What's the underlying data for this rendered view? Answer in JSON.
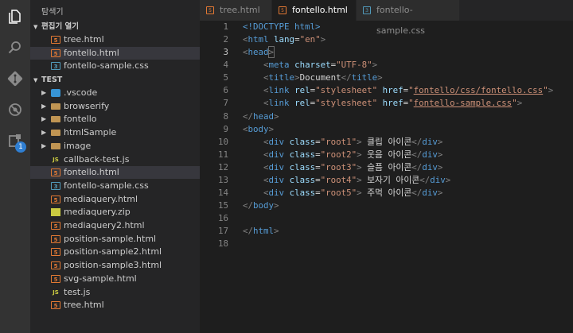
{
  "sidebar": {
    "title": "탐색기",
    "open_editors_label": "편집기 열기",
    "open_editors": [
      {
        "label": "tree.html",
        "type": "html",
        "selected": false
      },
      {
        "label": "fontello.html",
        "type": "html",
        "selected": true
      },
      {
        "label": "fontello-sample.css",
        "type": "css",
        "selected": false
      }
    ],
    "workspace_label": "TEST",
    "folders": [
      {
        "label": ".vscode",
        "type": "vscode"
      },
      {
        "label": "browserify",
        "type": "folder"
      },
      {
        "label": "fontello",
        "type": "folder"
      },
      {
        "label": "htmlSample",
        "type": "folder"
      },
      {
        "label": "image",
        "type": "folder"
      }
    ],
    "files": [
      {
        "label": "callback-test.js",
        "type": "js",
        "selected": false
      },
      {
        "label": "fontello.html",
        "type": "html",
        "selected": true
      },
      {
        "label": "fontello-sample.css",
        "type": "css",
        "selected": false
      },
      {
        "label": "mediaquery.html",
        "type": "html",
        "selected": false
      },
      {
        "label": "mediaquery.zip",
        "type": "zip",
        "selected": false
      },
      {
        "label": "mediaquery2.html",
        "type": "html",
        "selected": false
      },
      {
        "label": "position-sample.html",
        "type": "html",
        "selected": false
      },
      {
        "label": "position-sample2.html",
        "type": "html",
        "selected": false
      },
      {
        "label": "position-sample3.html",
        "type": "html",
        "selected": false
      },
      {
        "label": "svg-sample.html",
        "type": "html",
        "selected": false
      },
      {
        "label": "test.js",
        "type": "js",
        "selected": false
      },
      {
        "label": "tree.html",
        "type": "html",
        "selected": false
      }
    ]
  },
  "activity_bar": {
    "icons": [
      "files-icon",
      "search-icon",
      "source-control-icon",
      "debug-icon",
      "extensions-icon"
    ],
    "extensions_badge": "1"
  },
  "tabs": [
    {
      "label": "tree.html",
      "type": "html",
      "active": false
    },
    {
      "label": "fontello.html",
      "type": "html",
      "active": true
    },
    {
      "label": "fontello-sample.css",
      "type": "css",
      "active": false
    }
  ],
  "editor": {
    "line_numbers": [
      "1",
      "2",
      "3",
      "4",
      "5",
      "6",
      "7",
      "8",
      "9",
      "10",
      "11",
      "12",
      "13",
      "14",
      "15",
      "16",
      "17",
      "18"
    ],
    "lines": [
      "<!DOCTYPE html>",
      "<html lang=\"en\">",
      "<head>",
      "    <meta charset=\"UTF-8\">",
      "    <title>Document</title>",
      "    <link rel=\"stylesheet\" href=\"fontello/css/fontello.css\">",
      "    <link rel=\"stylesheet\" href=\"fontello-sample.css\">",
      "</head>",
      "<body>",
      "    <div class=\"root1\"> 클립 아이콘</div>",
      "    <div class=\"root2\"> 웃음 아이콘</div>",
      "    <div class=\"root3\"> 슬픔 아이콘</div>",
      "    <div class=\"root4\"> 보자기 아이콘</div>",
      "    <div class=\"root5\"> 주먹 아이콘</div>",
      "</body>",
      "",
      "</html>",
      ""
    ]
  },
  "colors": {
    "activity_bar": "#333333",
    "sidebar": "#252526",
    "editor": "#1e1e1e",
    "selection": "#37373d",
    "tag": "#569cd6",
    "attribute": "#9cdcfe",
    "string": "#ce9178",
    "html_icon": "#e37933",
    "css_icon": "#519aba",
    "js_icon": "#cbcb41",
    "badge": "#2f7fd3"
  }
}
